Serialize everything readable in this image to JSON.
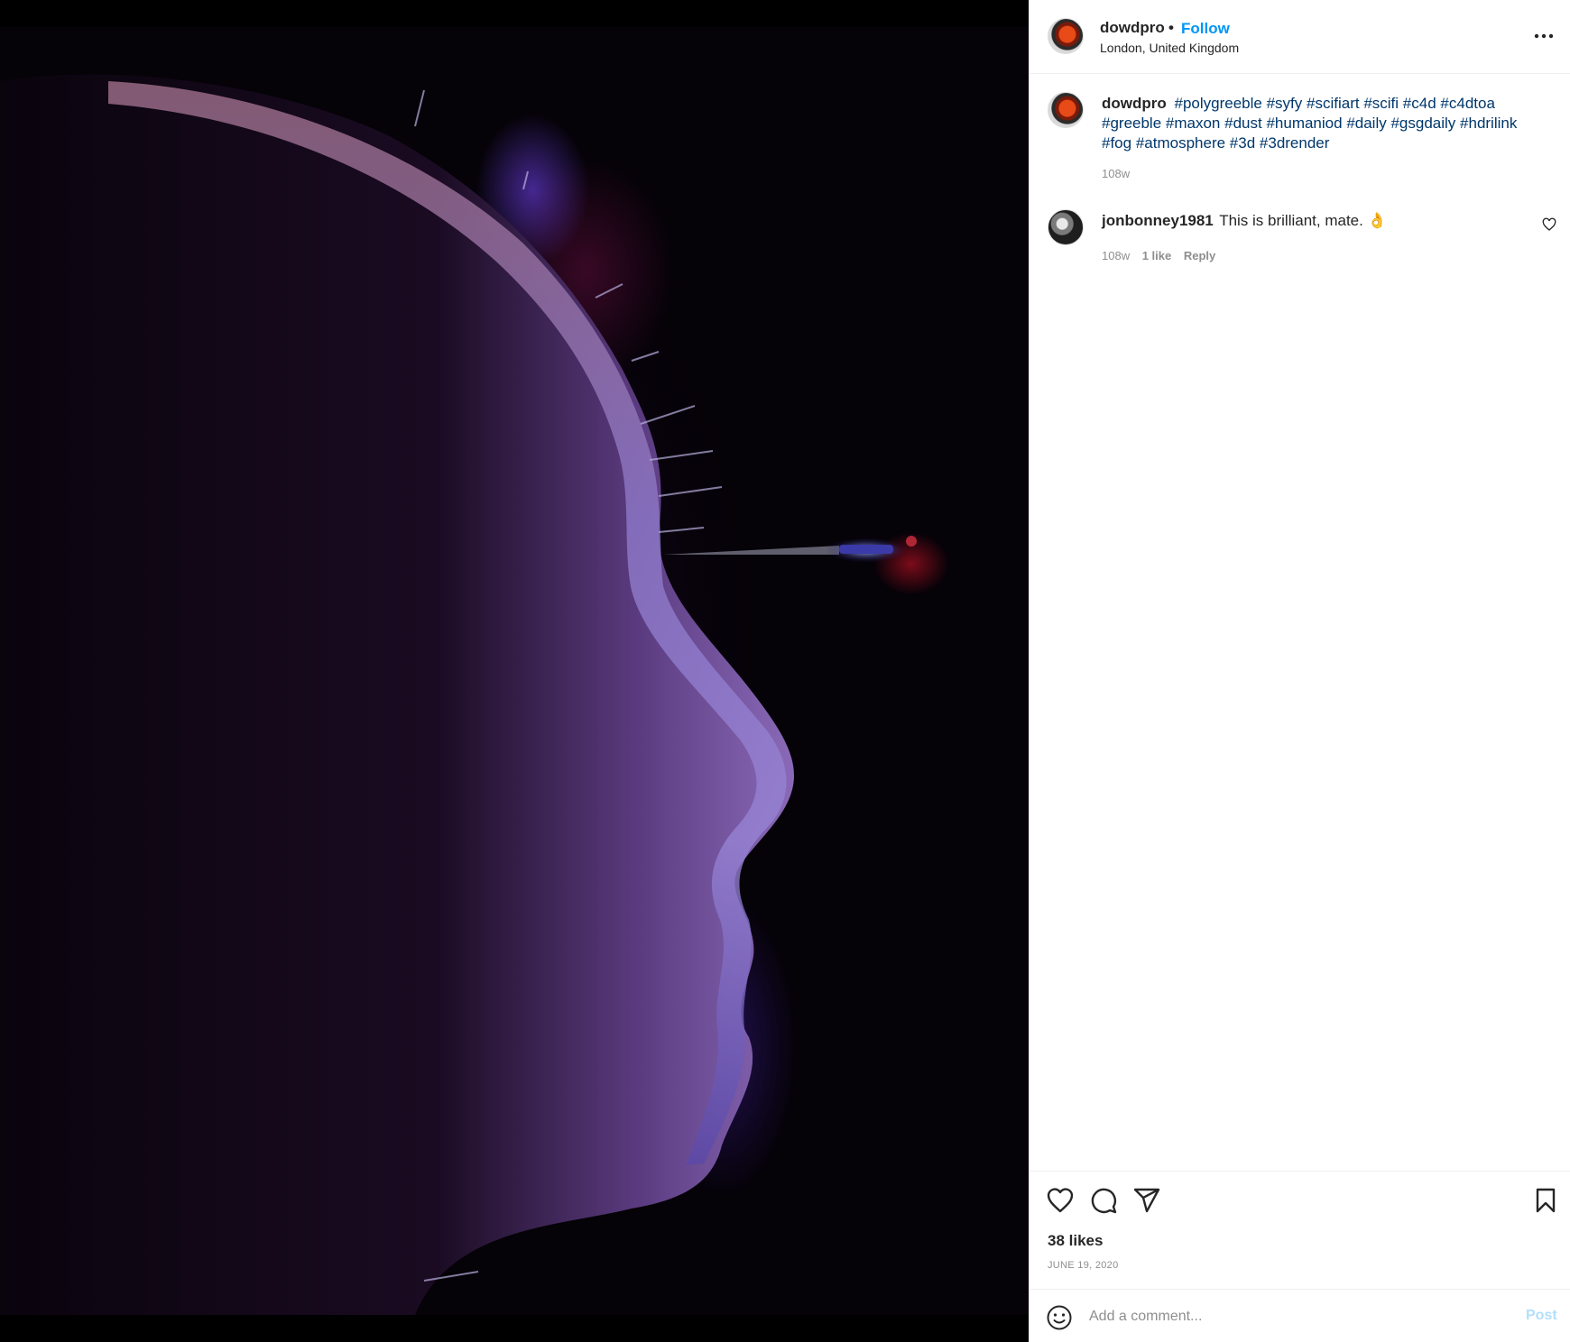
{
  "post": {
    "username": "dowdpro",
    "header_separator": "•",
    "follow_label": "Follow",
    "location": "London, United Kingdom",
    "more_icon": "more-horizontal-icon",
    "image": "cyber-humanoid-head-profile-render"
  },
  "caption": {
    "username": "dowdpro",
    "hashtags": [
      "#polygreeble",
      "#syfy",
      "#scifiart",
      "#scifi",
      "#c4d",
      "#c4dtoa",
      "#greeble",
      "#maxon",
      "#dust",
      "#humaniod",
      "#daily",
      "#gsgdaily",
      "#hdrilink",
      "#fog",
      "#atmosphere",
      "#3d",
      "#3drender"
    ],
    "time": "108w"
  },
  "comments": [
    {
      "username": "jonbonney1981",
      "text": "This is brilliant, mate. 👌",
      "time": "108w",
      "likes": "1 like",
      "reply_label": "Reply"
    }
  ],
  "actions": {
    "likes": "38 likes",
    "date": "JUNE 19, 2020",
    "icons": [
      "heart-icon",
      "comment-icon",
      "share-icon",
      "bookmark-icon"
    ]
  },
  "add_comment": {
    "placeholder": "Add a comment...",
    "post_label": "Post"
  },
  "colors": {
    "link_blue": "#0095f6",
    "hashtag_navy": "#00376b",
    "muted_gray": "#8e8e8e",
    "post_disabled": "#b2dffc"
  }
}
